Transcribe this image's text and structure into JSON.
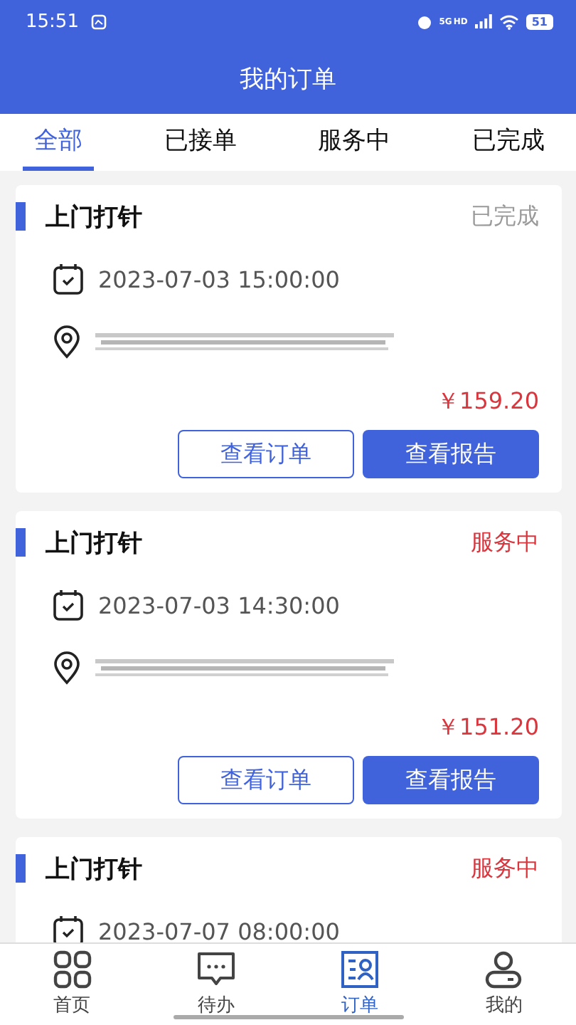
{
  "status_bar": {
    "time": "15:51",
    "network": [
      "5G",
      "HD"
    ],
    "battery": "51"
  },
  "header": {
    "title": "我的订单"
  },
  "tabs": [
    {
      "label": "全部",
      "selected": true
    },
    {
      "label": "已接单",
      "selected": false
    },
    {
      "label": "服务中",
      "selected": false
    },
    {
      "label": "已完成",
      "selected": false
    }
  ],
  "orders": [
    {
      "title": "上门打针",
      "status": "已完成",
      "kind": "done",
      "datetime": "2023-07-03 15:00:00",
      "price": "￥159.20",
      "buttons": [
        "查看订单",
        "查看报告"
      ]
    },
    {
      "title": "上门打针",
      "status": "服务中",
      "kind": "active",
      "datetime": "2023-07-03 14:30:00",
      "price": "￥151.20",
      "buttons": [
        "查看订单",
        "查看报告"
      ]
    },
    {
      "title": "上门打针",
      "status": "服务中",
      "kind": "active",
      "datetime": "2023-07-07 08:00:00"
    }
  ],
  "bottom_nav": [
    {
      "label": "首页",
      "kind": "grid",
      "selected": false
    },
    {
      "label": "待办",
      "kind": "chat",
      "selected": false
    },
    {
      "label": "订单",
      "kind": "orders",
      "selected": true
    },
    {
      "label": "我的",
      "kind": "user",
      "selected": false
    }
  ]
}
